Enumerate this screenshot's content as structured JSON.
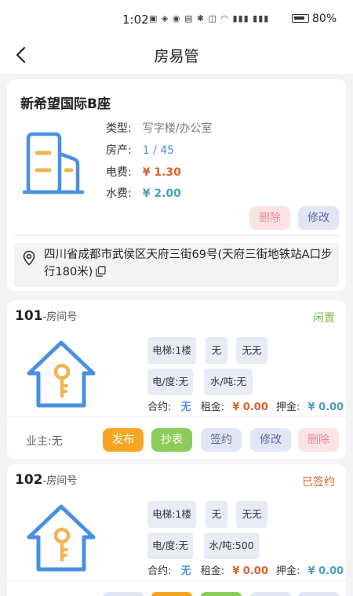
{
  "status_bar": {
    "time": "1:02",
    "battery": "80%"
  },
  "nav": {
    "title": "房易管"
  },
  "property": {
    "name": "新希望国际B座",
    "type_label": "类型:",
    "type_value": "写字楼/办公室",
    "count_label": "房产:",
    "count_value": "1 / 45",
    "electric_label": "电费:",
    "electric_value": "¥ 1.30",
    "water_label": "水费:",
    "water_value": "¥ 2.00",
    "delete_label": "删除",
    "edit_label": "修改",
    "address": "四川省成都市武侯区天府三街69号(天府三街地铁站A口步行180米)"
  },
  "rooms": [
    {
      "number": "101",
      "suffix": "-房间号",
      "status": "闲置",
      "tag_elevator": "电梯:1楼",
      "tag_none": "无",
      "tag_none2": "无无",
      "tag_elec": "电/度:无",
      "tag_water": "水/吨:无",
      "contract_label": "合约:",
      "contract_value": "无",
      "rent_label": "租金:",
      "rent_value": "¥ 0.00",
      "deposit_label": "押金:",
      "deposit_value": "¥ 0.00",
      "owner": "业主:无",
      "publish_label": "发布",
      "meter_label": "抄表",
      "sign_label": "签约",
      "edit_label": "修改",
      "delete_label": "删除"
    },
    {
      "number": "102",
      "suffix": "-房间号",
      "status": "已签约",
      "tag_elevator": "电梯:1楼",
      "tag_none": "无",
      "tag_none2": "无无",
      "tag_elec": "电/度:无",
      "tag_water": "水/吨:500",
      "contract_label": "合约:",
      "contract_value": "无",
      "rent_label": "租金:",
      "rent_value": "¥ 0.00",
      "deposit_label": "押金:",
      "deposit_value": "¥ 0.00"
    }
  ],
  "colors": {
    "accent_blue": "#4a90e2",
    "key_gold": "#f0b450",
    "price_red": "#d9622b",
    "status_idle": "#7bbf4f",
    "status_signed": "#d9622b",
    "publish_orange": "#f6a623",
    "meter_green": "#8ccc5a"
  },
  "icons": {
    "back": "chevron-left-icon",
    "building": "building-icon",
    "location": "location-pin-icon",
    "copy": "copy-icon",
    "house": "house-key-icon"
  }
}
